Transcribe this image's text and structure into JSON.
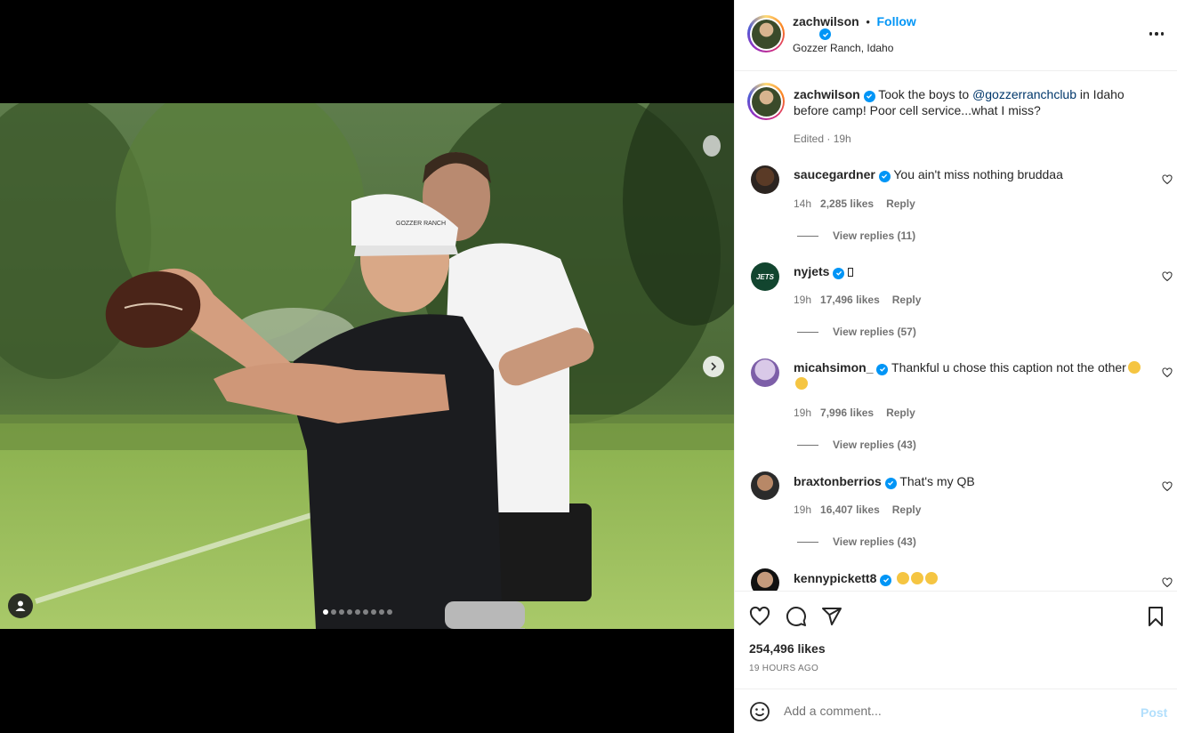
{
  "post": {
    "username": "zachwilson",
    "follow_label": "Follow",
    "location": "Gozzer Ranch, Idaho",
    "caption_pre": "Took the boys to ",
    "caption_mention": "@gozzerranchclub",
    "caption_post": " in Idaho before camp! Poor cell service...what I miss?",
    "edited": "Edited · 19h",
    "likes_total": "254,496 likes",
    "time_ago": "19 HOURS AGO",
    "carousel_count": 9,
    "carousel_active": 1,
    "cap_text": "GOZZER RANCH"
  },
  "comments": [
    {
      "user": "saucegardner",
      "text": "You ain't miss nothing bruddaa",
      "time": "14h",
      "likes": "2,285 likes",
      "reply": "Reply",
      "view_replies": "View replies (11)"
    },
    {
      "user": "nyjets",
      "text": "",
      "time": "19h",
      "likes": "17,496 likes",
      "reply": "Reply",
      "view_replies": "View replies (57)"
    },
    {
      "user": "micahsimon_",
      "text": "Thankful u chose this caption not the other",
      "time": "19h",
      "likes": "7,996 likes",
      "reply": "Reply",
      "view_replies": "View replies (43)"
    },
    {
      "user": "braxtonberrios",
      "text": "That's my QB",
      "time": "19h",
      "likes": "16,407 likes",
      "reply": "Reply",
      "view_replies": "View replies (43)"
    },
    {
      "user": "kennypickett8",
      "text": ""
    }
  ],
  "add_comment": {
    "placeholder": "Add a comment...",
    "post_label": "Post"
  },
  "colors": {
    "accent": "#0095f6",
    "verified": "#0095f6",
    "muted": "#737373",
    "post_disabled": "#b2dffc"
  },
  "icons": [
    "more-icon",
    "verified-icon",
    "heart-icon",
    "comment-icon",
    "share-icon",
    "bookmark-icon",
    "emoji-icon",
    "chevron-right-icon",
    "user-tag-icon"
  ]
}
